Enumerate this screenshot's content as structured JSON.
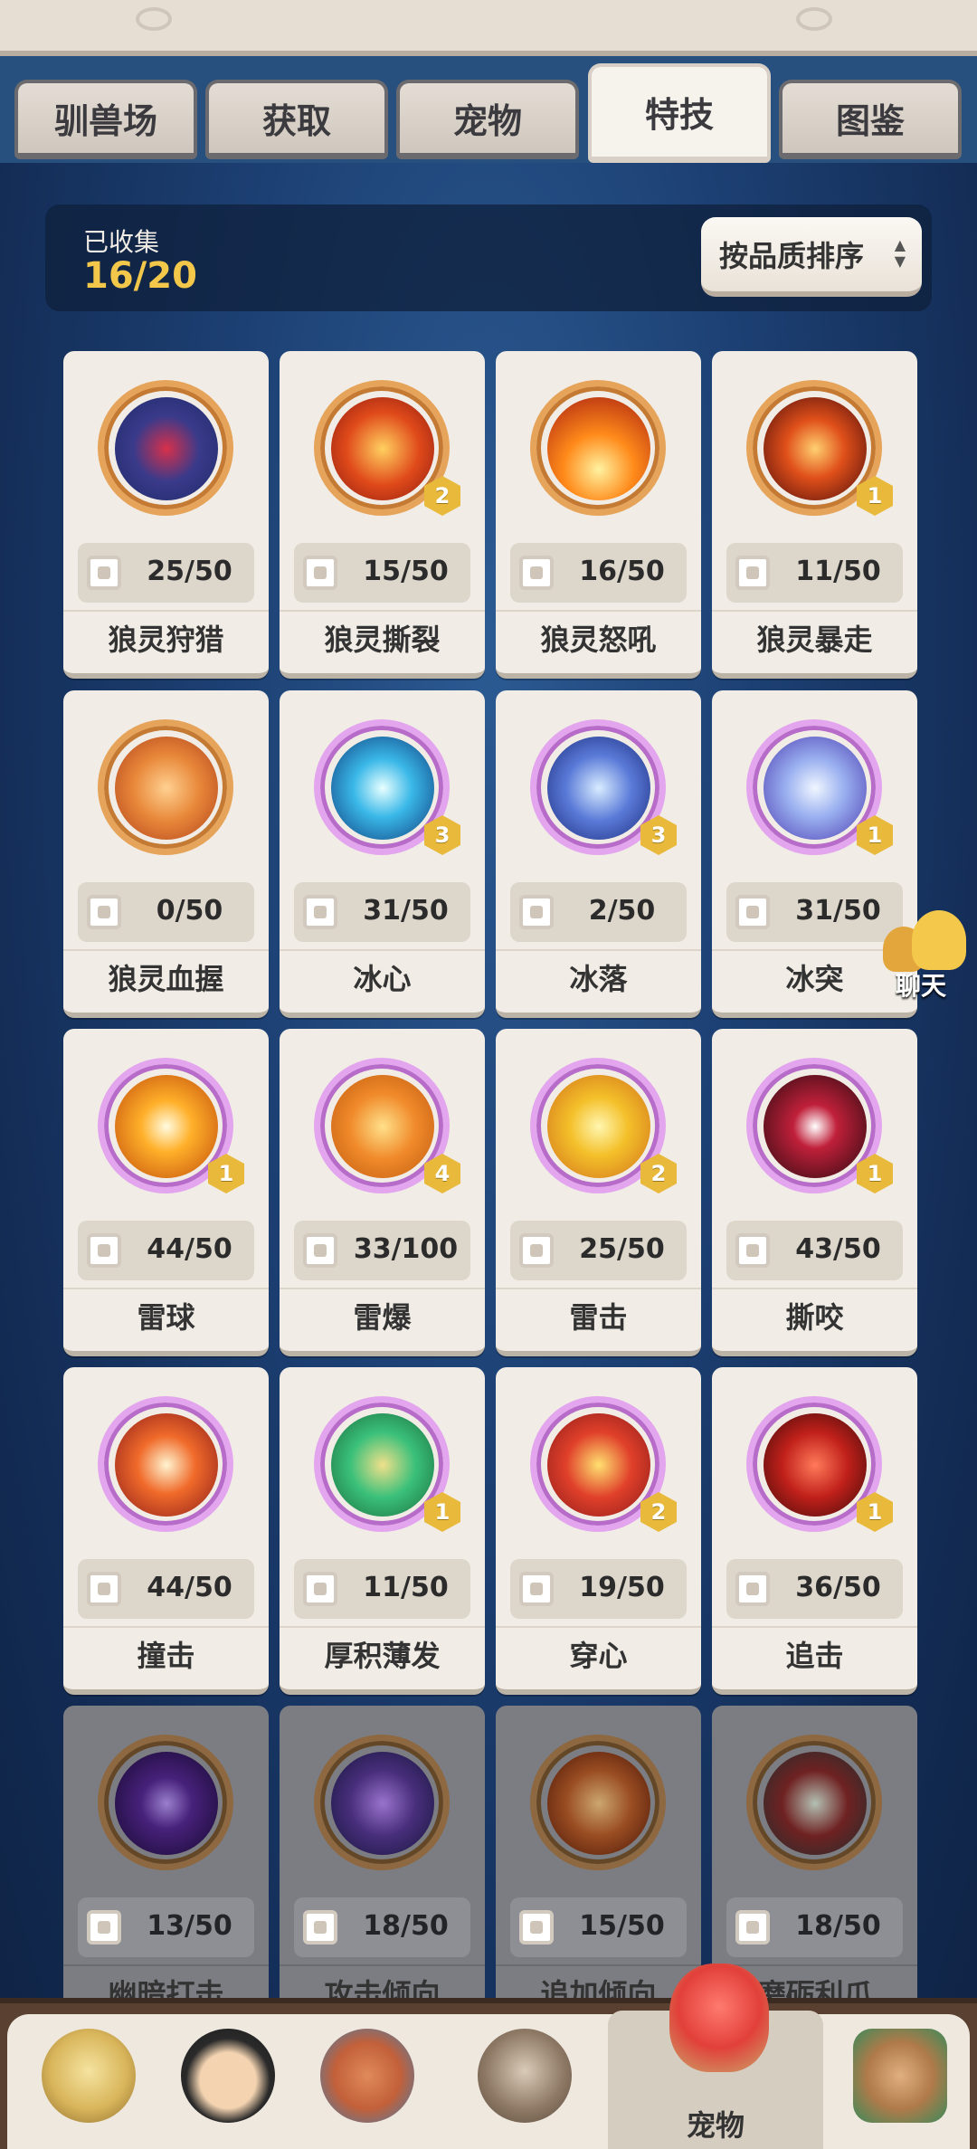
{
  "tabs": [
    {
      "label": "驯兽场",
      "active": false
    },
    {
      "label": "获取",
      "active": false
    },
    {
      "label": "宠物",
      "active": false
    },
    {
      "label": "特技",
      "active": true
    },
    {
      "label": "图鉴",
      "active": false
    }
  ],
  "collection": {
    "label": "已收集",
    "value": "16/20"
  },
  "sort_button": {
    "label": "按品质排序"
  },
  "skills": [
    {
      "name": "狼灵狩猎",
      "progress": "25/50",
      "level": "",
      "frame": "orange",
      "icon": "heart-target-icon",
      "locked": false
    },
    {
      "name": "狼灵撕裂",
      "progress": "15/50",
      "level": "2",
      "frame": "orange",
      "icon": "claw-slash-icon",
      "locked": false
    },
    {
      "name": "狼灵怒吼",
      "progress": "16/50",
      "level": "",
      "frame": "orange",
      "icon": "roar-blast-icon",
      "locked": false
    },
    {
      "name": "狼灵暴走",
      "progress": "11/50",
      "level": "1",
      "frame": "orange",
      "icon": "rampage-slash-icon",
      "locked": false
    },
    {
      "name": "狼灵血握",
      "progress": "0/50",
      "level": "",
      "frame": "orange",
      "icon": "paw-icon",
      "locked": false
    },
    {
      "name": "冰心",
      "progress": "31/50",
      "level": "3",
      "frame": "purple",
      "icon": "snowflake-icon",
      "locked": false
    },
    {
      "name": "冰落",
      "progress": "2/50",
      "level": "3",
      "frame": "purple",
      "icon": "ice-shard-icon",
      "locked": false
    },
    {
      "name": "冰突",
      "progress": "31/50",
      "level": "1",
      "frame": "purple",
      "icon": "ice-crystal-icon",
      "locked": false
    },
    {
      "name": "雷球",
      "progress": "44/50",
      "level": "1",
      "frame": "purple",
      "icon": "thunder-ball-icon",
      "locked": false
    },
    {
      "name": "雷爆",
      "progress": "33/100",
      "level": "4",
      "frame": "purple",
      "icon": "lightning-burst-icon",
      "locked": false
    },
    {
      "name": "雷击",
      "progress": "25/50",
      "level": "2",
      "frame": "purple",
      "icon": "lightning-strike-icon",
      "locked": false
    },
    {
      "name": "撕咬",
      "progress": "43/50",
      "level": "1",
      "frame": "purple",
      "icon": "bite-jaws-icon",
      "locked": false
    },
    {
      "name": "撞击",
      "progress": "44/50",
      "level": "",
      "frame": "purple",
      "icon": "impact-icon",
      "locked": false
    },
    {
      "name": "厚积薄发",
      "progress": "11/50",
      "level": "1",
      "frame": "purple",
      "icon": "hourglass-icon",
      "locked": false
    },
    {
      "name": "穿心",
      "progress": "19/50",
      "level": "2",
      "frame": "purple",
      "icon": "fist-stars-icon",
      "locked": false
    },
    {
      "name": "追击",
      "progress": "36/50",
      "level": "1",
      "frame": "purple",
      "icon": "chase-strike-icon",
      "locked": false
    },
    {
      "name": "幽暗打击",
      "progress": "13/50",
      "level": "",
      "frame": "orange",
      "icon": "dark-strike-icon",
      "locked": true
    },
    {
      "name": "攻击倾向",
      "progress": "18/50",
      "level": "",
      "frame": "orange",
      "icon": "attack-spirit-icon",
      "locked": true
    },
    {
      "name": "追加倾向",
      "progress": "15/50",
      "level": "",
      "frame": "orange",
      "icon": "extra-spirit-icon",
      "locked": true
    },
    {
      "name": "磨砺利爪",
      "progress": "18/50",
      "level": "",
      "frame": "orange",
      "icon": "sharpen-claw-icon",
      "locked": true
    }
  ],
  "chat": {
    "label": "聊天"
  },
  "bottom_nav": {
    "active_label": "宠物",
    "items": [
      "hero-lion-avatar",
      "hero-ninja-avatar",
      "hero-totem-avatar",
      "hero-ape-avatar",
      "pet-dragon-avatar",
      "hero-tiki-avatar"
    ]
  },
  "colors": {
    "accent_gold": "#f3c84a",
    "orange_frame": "#e6a35a",
    "purple_frame": "#e3a6ee",
    "badge": "#e9b93b"
  }
}
